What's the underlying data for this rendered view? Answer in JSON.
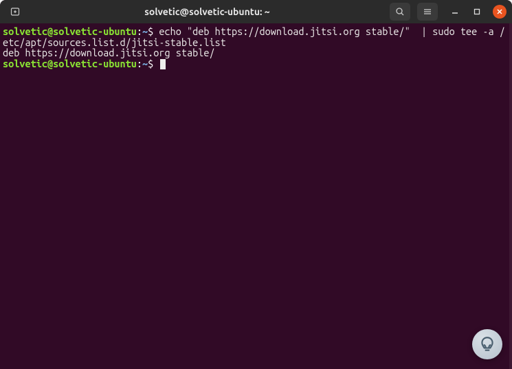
{
  "titlebar": {
    "title": "solvetic@solvetic-ubuntu: ~",
    "icons": {
      "new_tab": "new-tab-icon",
      "search": "search-icon",
      "menu": "menu-icon",
      "minimize": "minimize-icon",
      "maximize": "maximize-icon",
      "close": "close-icon"
    }
  },
  "terminal": {
    "lines": [
      {
        "prompt": {
          "user": "solvetic@solvetic-ubuntu",
          "path": "~",
          "symbol": "$"
        },
        "command": "echo \"deb https://download.jitsi.org stable/\"  | sudo tee -a /etc/apt/sources.list.d/jitsi-stable.list"
      },
      {
        "output": "deb https://download.jitsi.org stable/"
      },
      {
        "prompt": {
          "user": "solvetic@solvetic-ubuntu",
          "path": "~",
          "symbol": "$"
        },
        "command": "",
        "cursor": true
      }
    ]
  },
  "assistant": {
    "label": "help-bubble"
  }
}
